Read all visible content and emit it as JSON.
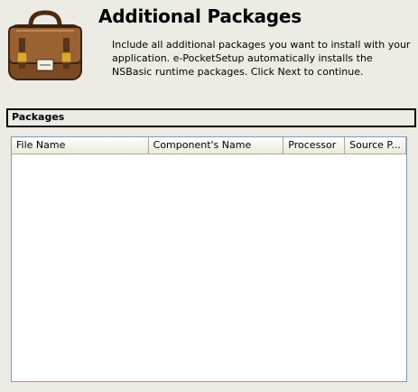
{
  "header": {
    "title": "Additional Packages",
    "description": "Include all additional packages you want to install with your application. e-PocketSetup automatically installs the NSBasic runtime packages. Click Next to continue.",
    "icon": "satchel-icon"
  },
  "packages": {
    "section_label": "Packages",
    "columns": [
      "File Name",
      "Component's Name",
      "Processor",
      "Source P..."
    ],
    "rows": []
  },
  "colors": {
    "background": "#ecebe4",
    "list_background": "#ffffff",
    "list_border": "#7f9db9"
  }
}
